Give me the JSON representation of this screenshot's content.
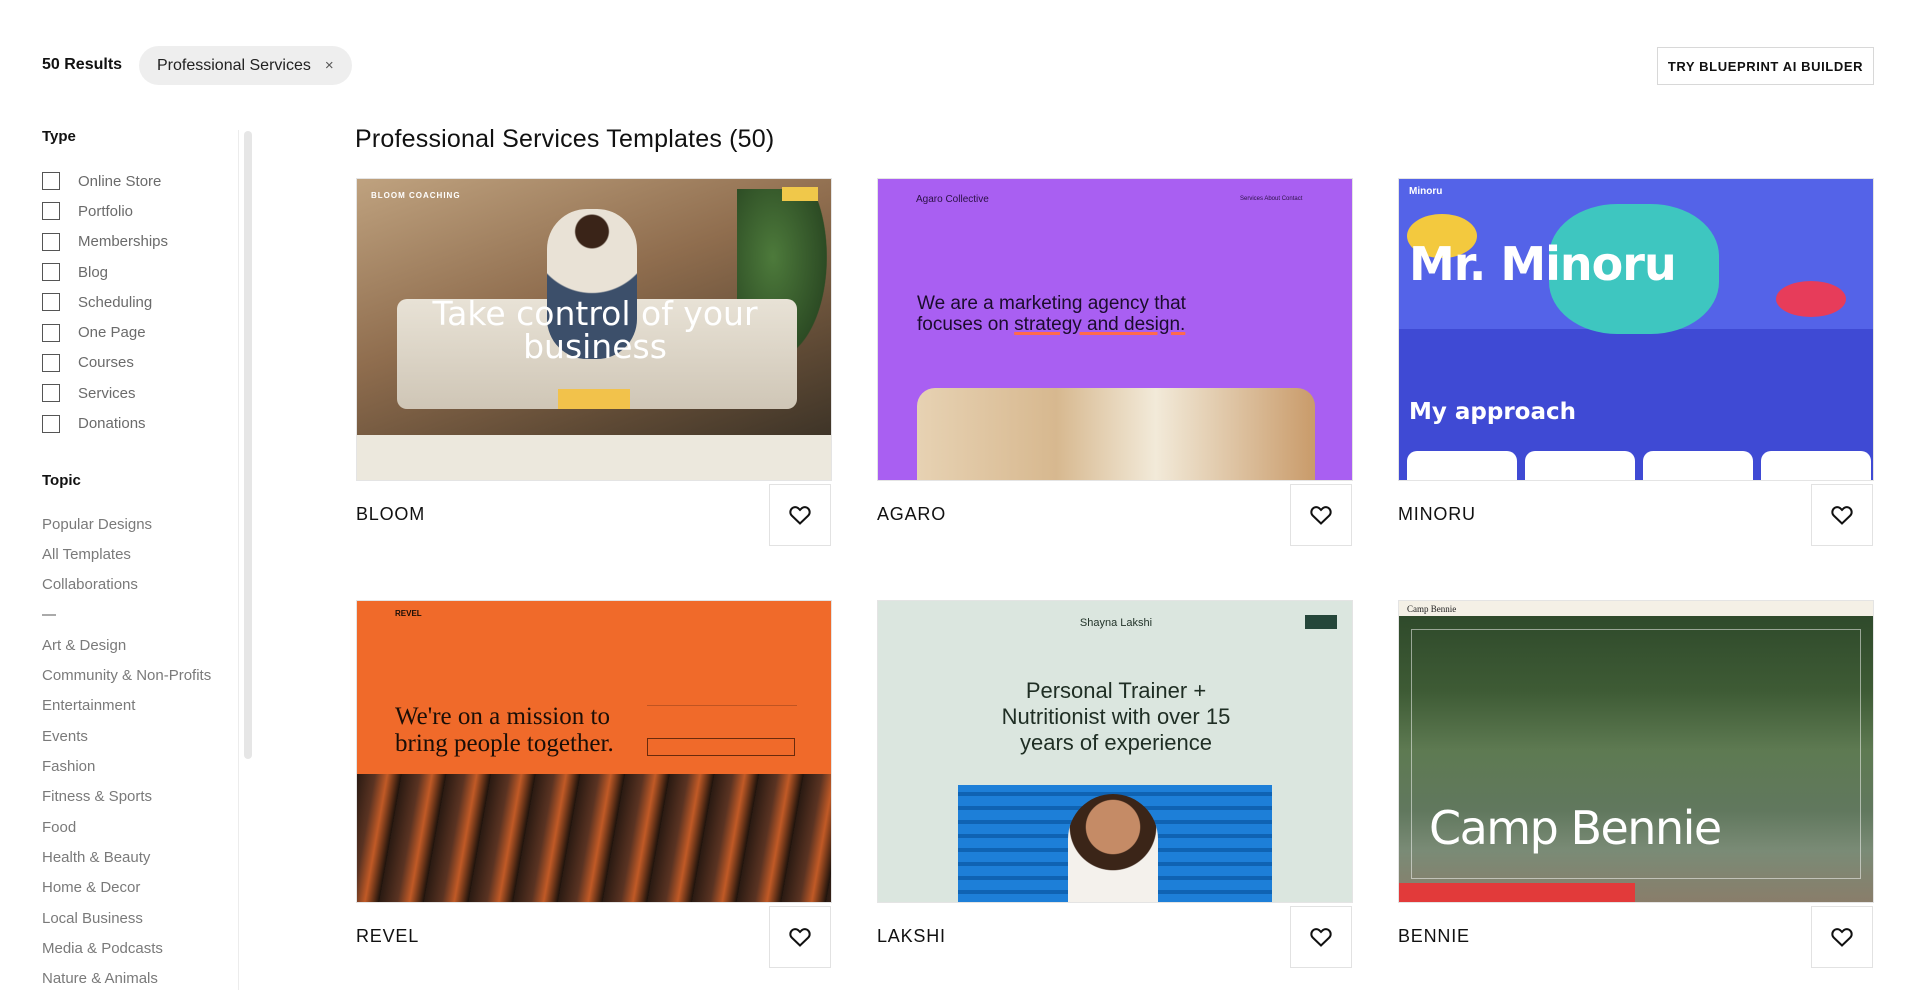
{
  "header": {
    "results_count": "50 Results",
    "active_filter": "Professional Services",
    "filter_close": "×",
    "ai_builder_label": "TRY BLUEPRINT AI BUILDER"
  },
  "sidebar": {
    "type_heading": "Type",
    "types": [
      "Online Store",
      "Portfolio",
      "Memberships",
      "Blog",
      "Scheduling",
      "One Page",
      "Courses",
      "Services",
      "Donations"
    ],
    "topic_heading": "Topic",
    "topics_top": [
      "Popular Designs",
      "All Templates",
      "Collaborations"
    ],
    "topics": [
      "Art & Design",
      "Community & Non-Profits",
      "Entertainment",
      "Events",
      "Fashion",
      "Fitness & Sports",
      "Food",
      "Health & Beauty",
      "Home & Decor",
      "Local Business",
      "Media & Podcasts",
      "Nature & Animals"
    ]
  },
  "main": {
    "title": "Professional Services Templates (50)",
    "templates": [
      {
        "name": "BLOOM",
        "preview": {
          "brand": "BLOOM COACHING",
          "headline": "Take control of your business"
        }
      },
      {
        "name": "AGARO",
        "preview": {
          "brand": "Agaro Collective",
          "nav": "Services   About   Contact",
          "headline_a": "We are a marketing agency that focuses on ",
          "headline_b": "strategy and design."
        }
      },
      {
        "name": "MINORU",
        "preview": {
          "logo": "Minoru",
          "title": "Mr. Minoru",
          "subtitle": "My approach"
        }
      },
      {
        "name": "REVEL",
        "preview": {
          "logo": "REVEL",
          "headline": "We're on a mission to bring people together."
        }
      },
      {
        "name": "LAKSHI",
        "preview": {
          "brand": "Shayna Lakshi",
          "headline": "Personal Trainer + Nutritionist with over 15 years of experience"
        }
      },
      {
        "name": "BENNIE",
        "preview": {
          "brand": "Camp Bennie",
          "title": "Camp Bennie"
        }
      }
    ]
  },
  "icons": {
    "favorite": "heart-icon",
    "checkbox": "checkbox-icon",
    "close": "close-icon"
  }
}
